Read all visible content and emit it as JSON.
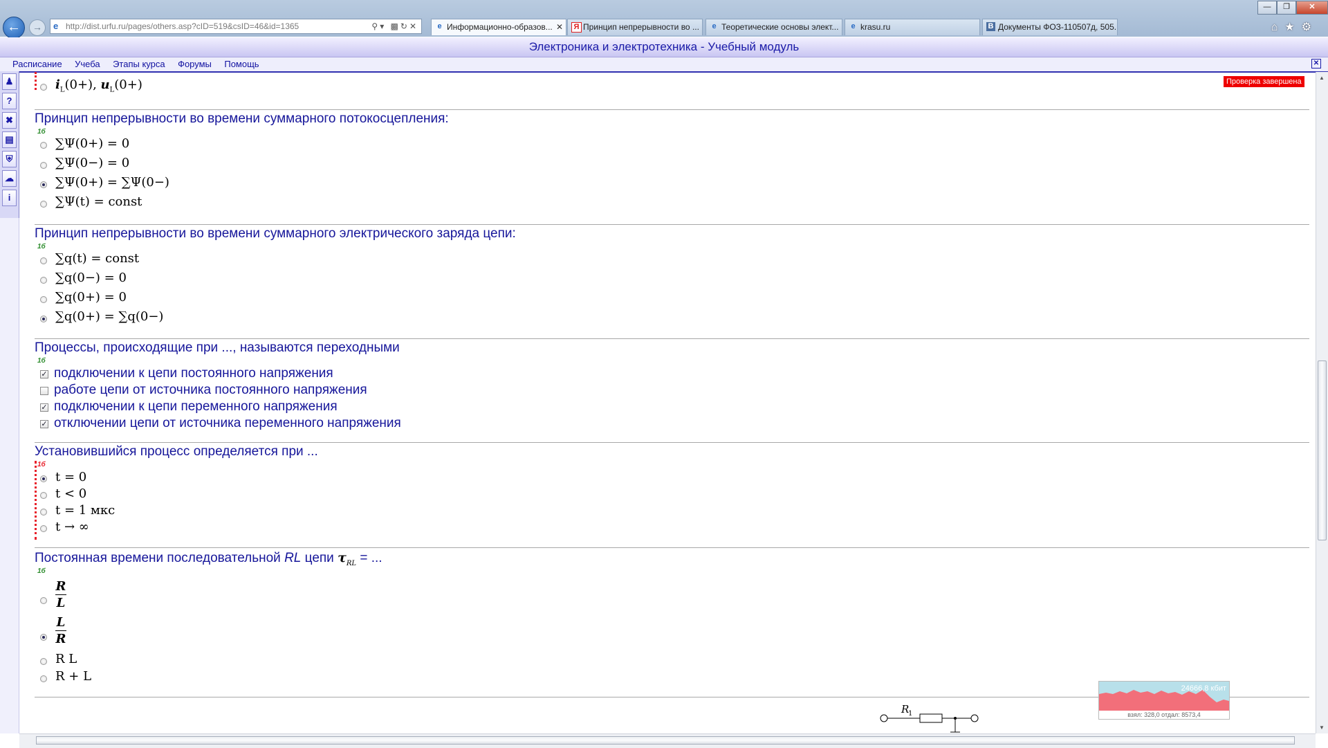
{
  "browser": {
    "address": "http://dist.urfu.ru/pages/others.asp?cID=519&csID=46&id=1365",
    "tabs": [
      {
        "label": "Информационно-образов...",
        "icon": "ie-icon",
        "active": true
      },
      {
        "label": "Принцип непрерывности во ...",
        "icon": "yandex-icon",
        "active": false
      },
      {
        "label": "Теоретические основы элект...",
        "icon": "ie-icon",
        "active": false
      },
      {
        "label": "krasu.ru",
        "icon": "ie-icon",
        "active": false
      },
      {
        "label": "Документы ФОЗ-110507д, 505...",
        "icon": "vk-icon",
        "active": false
      }
    ]
  },
  "app": {
    "title": "Электроника и электротехника - Учебный модуль",
    "menu": [
      "Расписание",
      "Учеба",
      "Этапы курса",
      "Форумы",
      "Помощь"
    ],
    "status_badge": "Проверка завершена"
  },
  "questions": [
    {
      "title": "Принцип непрерывности во времени суммарного потокосцепления:",
      "points": "1б",
      "options": [
        "∑Ψ(0+) = 0",
        "∑Ψ(0−) = 0",
        "∑Ψ(0+) = ∑Ψ(0−)",
        "∑Ψ(t) = const"
      ],
      "selected": 2
    },
    {
      "title": "Принцип непрерывности во времени суммарного электрического заряда цепи:",
      "points": "1б",
      "options": [
        "∑q(t) = const",
        "∑q(0−) = 0",
        "∑q(0+) = 0",
        "∑q(0+) = ∑q(0−)"
      ],
      "selected": 3
    },
    {
      "title": "Процессы, происходящие при ..., называются переходными",
      "points": "1б",
      "options": [
        "подключении к цепи постоянного напряжения",
        "работе цепи от источника постоянного напряжения",
        "подключении к цепи переменного напряжения",
        "отключении цепи от источника переменного напряжения"
      ],
      "checked": [
        true,
        false,
        true,
        true
      ]
    },
    {
      "title": "Установившийся процесс определяется при ...",
      "points": "1б",
      "options": [
        "t = 0",
        "t < 0",
        "t = 1 мкс",
        "t → ∞"
      ],
      "selected": 0
    },
    {
      "title_prefix": "Постоянная времени последовательной ",
      "title_rl": "RL",
      "title_mid": " цепи ",
      "title_tau": "τ",
      "title_sub": "RL",
      "title_suffix": " = ...",
      "points": "1б",
      "options": [
        "R/L",
        "L/R",
        "R L",
        "R + L"
      ],
      "selected": 1
    }
  ],
  "prev_option": "i_L(0+), u_L(0+)",
  "prev_option_i": "i",
  "prev_option_u": "u",
  "prev_option_sub": "L",
  "prev_option_arg": "(0+)",
  "circuit_label": "R",
  "circuit_sub": "1",
  "network": {
    "speed": "24666,8 кбит",
    "stats": "взял: 328,0 отдал: 8573,4"
  }
}
